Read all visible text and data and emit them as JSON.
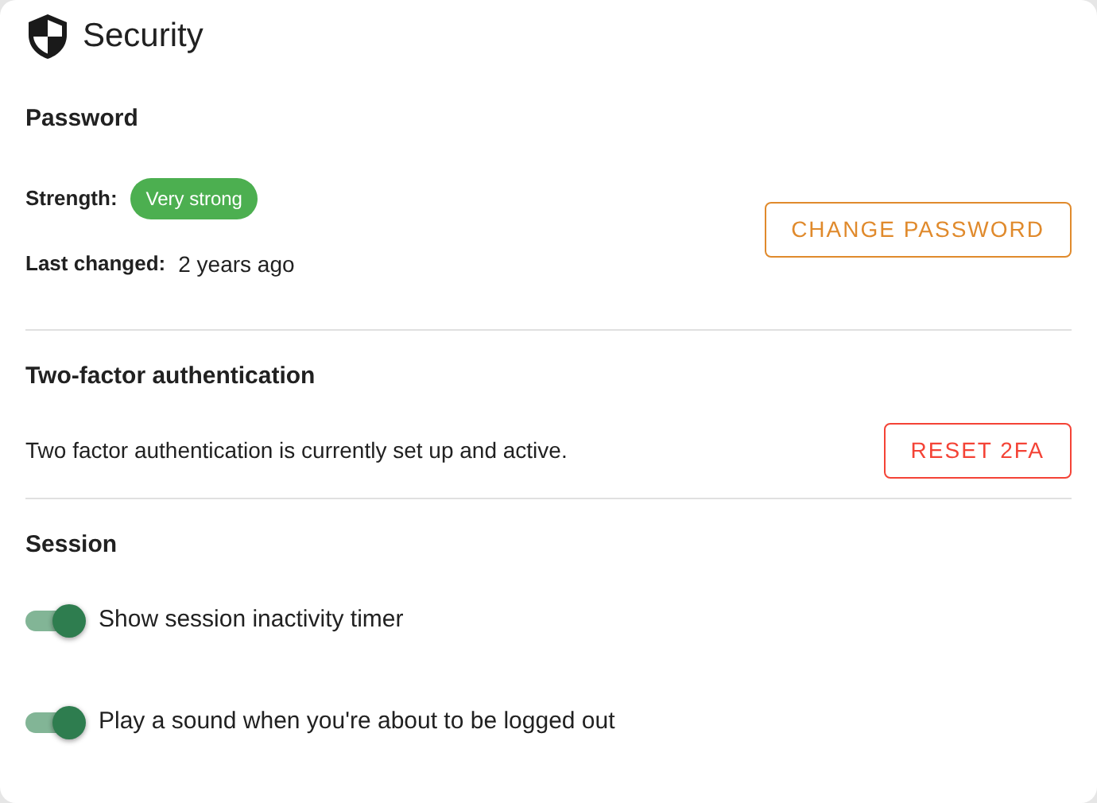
{
  "title": "Security",
  "password": {
    "heading": "Password",
    "strength_label": "Strength:",
    "strength": "Very strong",
    "changed_label": "Last changed:",
    "changed": "2 years ago",
    "button": "CHANGE PASSWORD"
  },
  "two_factor": {
    "heading": "Two-factor authentication",
    "text": "Two factor authentication is currently set up and active.",
    "button": "RESET 2FA"
  },
  "session": {
    "heading": "Session",
    "toggles": [
      {
        "label": "Show session inactivity timer",
        "on": true
      },
      {
        "label": "Play a sound when you're about to be logged out",
        "on": true
      }
    ]
  }
}
